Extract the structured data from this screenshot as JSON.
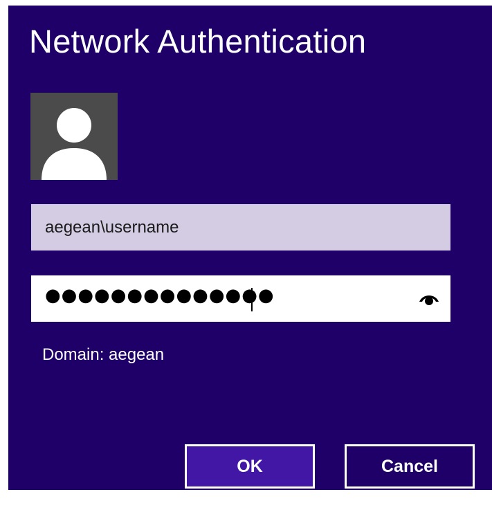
{
  "dialog": {
    "title": "Network Authentication",
    "background_color": "#1f0068"
  },
  "avatar": {
    "icon": "user-silhouette-icon"
  },
  "username": {
    "value": "aegean\\username"
  },
  "password": {
    "masked_value": "●●●●●●●●●●●●●●",
    "reveal_icon": "eye-icon"
  },
  "domain": {
    "text": "Domain: aegean"
  },
  "buttons": {
    "ok_label": "OK",
    "cancel_label": "Cancel",
    "ok_color": "#4217a6"
  }
}
